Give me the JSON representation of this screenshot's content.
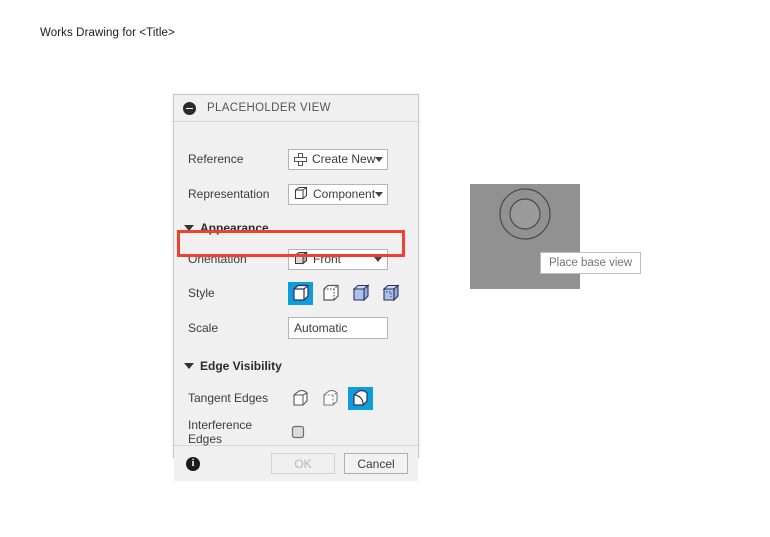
{
  "page": {
    "title": "Works Drawing for <Title>"
  },
  "dialog": {
    "title": "PLACEHOLDER VIEW",
    "collapse_icon": "minus-circle-icon",
    "reference": {
      "label": "Reference",
      "value": "Create New",
      "icon": "plus-icon"
    },
    "representation": {
      "label": "Representation",
      "value": "Component",
      "icon": "cube-icon",
      "highlighted": true,
      "highlight_color": "#ef4130"
    },
    "appearance": {
      "label": "Appearance",
      "expanded": true,
      "orientation": {
        "label": "Orientation",
        "value": "Front",
        "icon": "cube-icon"
      },
      "style": {
        "label": "Style",
        "selected_index": 0,
        "options": [
          {
            "name": "visible-edges-icon"
          },
          {
            "name": "visible-and-hidden-edges-icon"
          },
          {
            "name": "shaded-icon"
          },
          {
            "name": "shaded-with-hidden-edges-icon"
          }
        ]
      },
      "scale": {
        "label": "Scale",
        "value": "Automatic"
      }
    },
    "edge_visibility": {
      "label": "Edge Visibility",
      "expanded": true,
      "tangent_edges": {
        "label": "Tangent Edges",
        "selected_index": 2,
        "options": [
          {
            "name": "tangent-edges-off-icon"
          },
          {
            "name": "tangent-edges-shortened-icon"
          },
          {
            "name": "tangent-edges-on-icon"
          }
        ]
      },
      "interference_edges": {
        "label": "Interference Edges",
        "checked": false,
        "icon": "interference-edges-icon"
      }
    },
    "footer": {
      "info_icon": "info-icon",
      "info_glyph": "i",
      "ok_label": "OK",
      "ok_disabled": true,
      "cancel_label": "Cancel"
    },
    "accent_color": "#0d9ddb"
  },
  "preview": {
    "tooltip": "Place base view",
    "background_color": "#919191"
  }
}
